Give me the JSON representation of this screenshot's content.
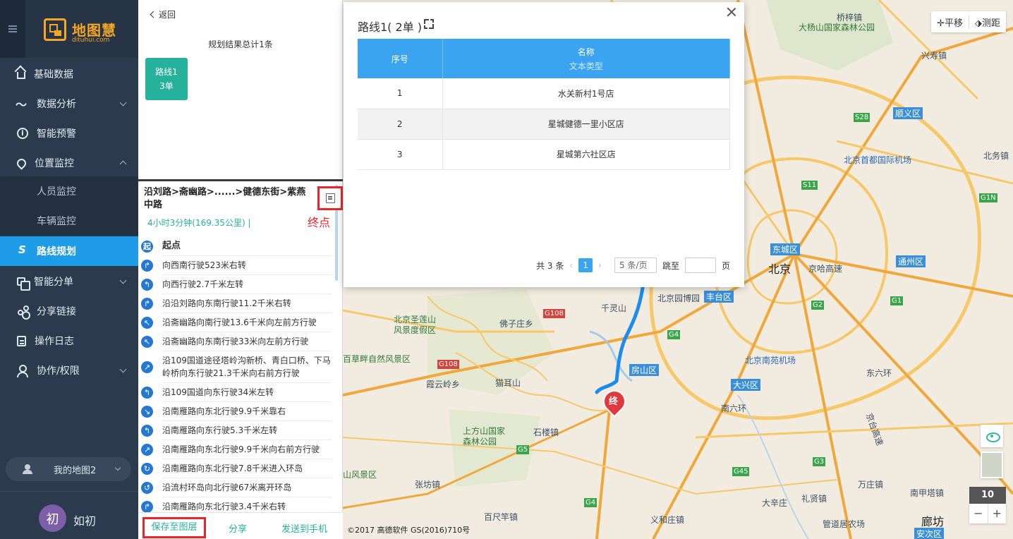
{
  "sidebar": {
    "logo_text": "地图慧",
    "logo_sub": "dituhui.com",
    "items": [
      {
        "label": "基础数据"
      },
      {
        "label": "数据分析"
      },
      {
        "label": "智能预警"
      },
      {
        "label": "位置监控"
      },
      {
        "label": "人员监控"
      },
      {
        "label": "车辆监控"
      },
      {
        "label": "路线规划"
      },
      {
        "label": "智能分单"
      },
      {
        "label": "分享链接"
      },
      {
        "label": "操作日志"
      },
      {
        "label": "协作/权限"
      }
    ],
    "my_map": "我的地图2",
    "user_avatar": "初",
    "user_name": "如初"
  },
  "route_panel": {
    "back": "返回",
    "result_total": "规划结果总计1条",
    "route_card": {
      "name": "路线1",
      "orders": "3单"
    },
    "summary": "沿刘路>斋幽路>......>健德东街>紫燕中路",
    "time": "4小时3分钟(169.35公里) |",
    "end_annotation": "终点",
    "steps": [
      {
        "icon": "起",
        "text": "起点"
      },
      {
        "icon": "↱",
        "text": "向西南行驶523米右转"
      },
      {
        "icon": "↰",
        "text": "向西行驶2.7千米左转"
      },
      {
        "icon": "↱",
        "text": "沿沿刘路向东南行驶11.2千米右转"
      },
      {
        "icon": "↖",
        "text": "沿斋幽路向南行驶13.6千米向左前方行驶"
      },
      {
        "icon": "↖",
        "text": "沿斋幽路向东南行驶33米向左前方行驶"
      },
      {
        "icon": "↗",
        "text": "沿109国道途径塔岭沟新桥、青白口桥、下马岭桥向东行驶21.3千米向右前方行驶"
      },
      {
        "icon": "↰",
        "text": "沿109国道向东行驶34米左转"
      },
      {
        "icon": "↘",
        "text": "沿南雁路向东北行驶9.9千米靠右"
      },
      {
        "icon": "↰",
        "text": "沿南雁路向东行驶5.3千米左转"
      },
      {
        "icon": "↗",
        "text": "沿南雁路向东北行驶9.9千米向右前方行驶"
      },
      {
        "icon": "↻",
        "text": "沿南雁路向东北行驶7.8千米进入环岛"
      },
      {
        "icon": "↺",
        "text": "沿流村环岛向北行驶67米离开环岛"
      },
      {
        "icon": "↱",
        "text": "沿南雁路向东北行驶3.4千米右转"
      }
    ],
    "footer": {
      "save": "保存至图层",
      "share": "分享",
      "send": "发送到手机"
    }
  },
  "modal": {
    "title": "路线1( 2单 )",
    "table": {
      "headers": [
        "序号",
        "名称"
      ],
      "header_sub": "文本类型",
      "rows": [
        [
          "1",
          "水关新村1号店"
        ],
        [
          "2",
          "星城健德一里小区店"
        ],
        [
          "3",
          "星城第六社区店"
        ]
      ]
    },
    "pager": {
      "total": "共 3 条",
      "current": "1",
      "page_size": "5 条/页",
      "jump": "跳至",
      "page_unit": "页"
    }
  },
  "map": {
    "tools": [
      "✛平移",
      "⬗测距"
    ],
    "zoom": "10",
    "zoom_out": "−",
    "zoom_in": "+",
    "end_marker": "终",
    "copyright": "©2017 高德软件 GS(2016)710号",
    "labels": {
      "beijing": "北京",
      "capital_airport": "北京首都国际机场",
      "nanyuan_airport": "北京南苑机场",
      "dayangshan": "大杨山国家森林公园",
      "shunyi": "顺义区",
      "dongcheng": "东城区",
      "tongzhou": "通州区",
      "fengtai": "丰台区",
      "fangshan": "房山区",
      "daxing": "大兴区",
      "tonglu": "通州",
      "yuanbo": "北京园博园",
      "qianlingshan": "千灵山",
      "shengshan": "北京圣莲山风景度假区",
      "caopan": "百草畔自然风景区",
      "maoershan": "猫耳山",
      "shangfangshan": "上方山国家森林公园",
      "shifo": "石楼镇",
      "zhangfang": "张坊镇",
      "baichi": "百尺竿镇",
      "yihe": "义和庄镇",
      "langfang": "廊坊",
      "anci": "安次区",
      "lixian": "礼贤镇",
      "guanyao": "管道居农场",
      "yuxin": "大辛庄",
      "wanzhuang": "万庄镇",
      "nannan": "南甲塔镇",
      "xingshou": "兴寿镇",
      "beixiao": "北务镇",
      "fengyun": "霞云岭乡",
      "foziz": "佛子庄乡",
      "shuishan": "山风景区",
      "jingha": "京哈高速",
      "jingtai": "东六环",
      "nanliu": "南六环",
      "jinghu": "京台高速",
      "qiaozi": "桥梓镇"
    },
    "road_tags": [
      "S28",
      "S11",
      "G1N",
      "G1",
      "G2",
      "G4",
      "G108",
      "G5",
      "G45",
      "G3",
      "G4",
      "G108"
    ]
  }
}
